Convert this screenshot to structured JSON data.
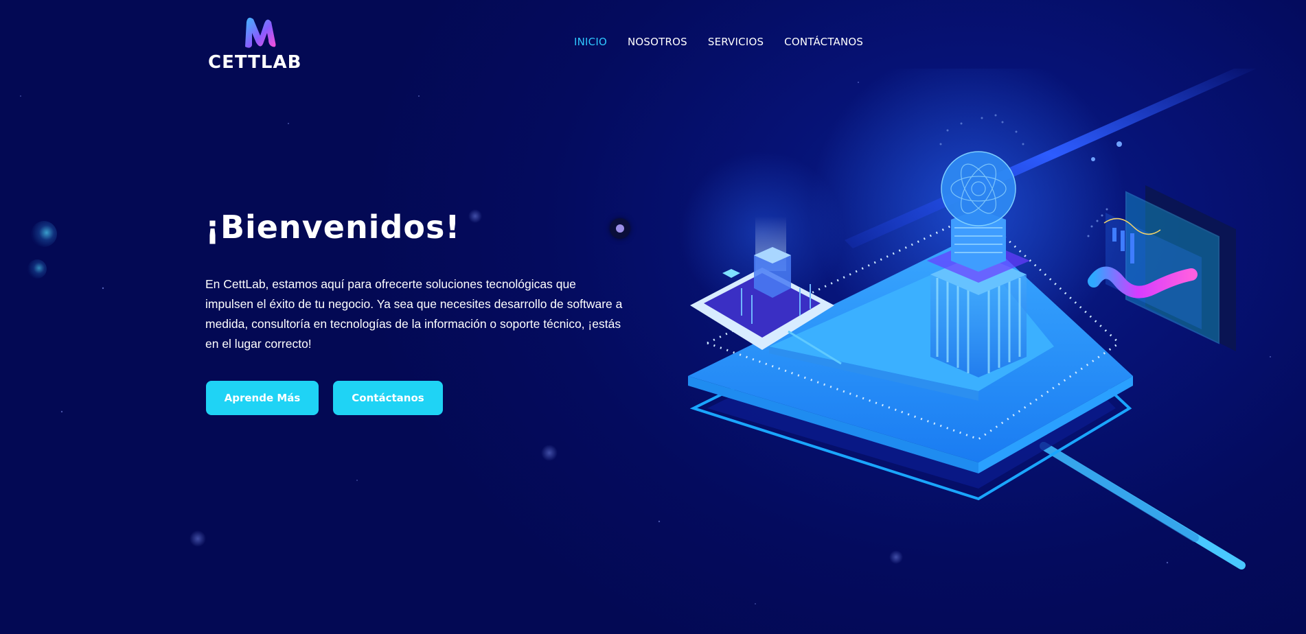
{
  "brand": {
    "name": "CETTLAB"
  },
  "nav": {
    "items": [
      "INICIO",
      "NOSOTROS",
      "SERVICIOS",
      "CONTÁCTANOS"
    ],
    "active": "INICIO"
  },
  "hero": {
    "title": "¡Bienvenidos!",
    "text": "En CettLab, estamos aquí para ofrecerte soluciones tecnológicas que impulsen el éxito de tu negocio. Ya sea que necesites desarrollo de software a medida, consultoría en tecnologías de la información o soporte técnico, ¡estás en el lugar correcto!",
    "buttons": {
      "learn_more": "Aprende Más",
      "contact": "Contáctanos"
    }
  },
  "colors": {
    "background": "#040b5e",
    "accent": "#1fd3f5",
    "nav_active": "#2fc7ff",
    "text": "#ffffff"
  },
  "icons": [
    "cettlab-logo-mark",
    "tech-isometric-illustration"
  ]
}
